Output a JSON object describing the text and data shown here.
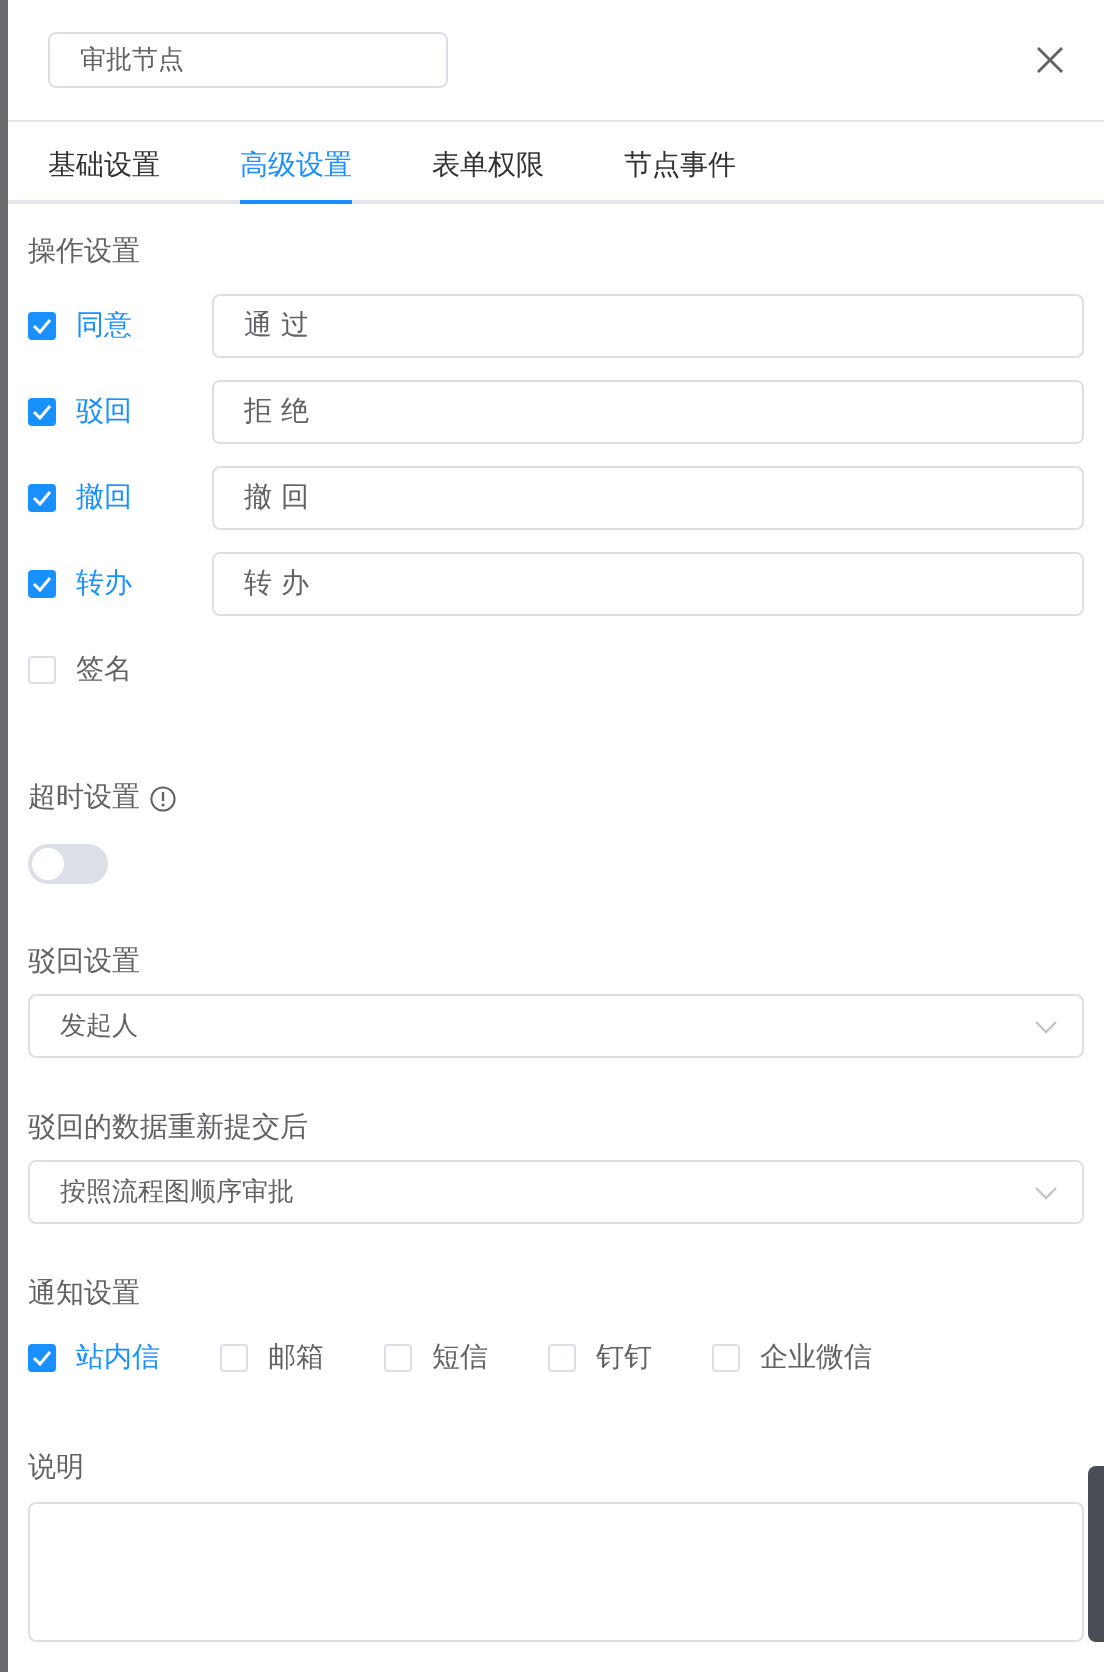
{
  "title_field": {
    "value": "审批节点"
  },
  "tabs": [
    {
      "label": "基础设置",
      "selected": false
    },
    {
      "label": "高级设置",
      "selected": true
    },
    {
      "label": "表单权限",
      "selected": false
    },
    {
      "label": "节点事件",
      "selected": false
    }
  ],
  "operations": {
    "label": "操作设置",
    "items": [
      {
        "kind": "with-input",
        "label": "同意",
        "checked": true,
        "value": "通 过"
      },
      {
        "kind": "with-input",
        "label": "驳回",
        "checked": true,
        "value": "拒 绝"
      },
      {
        "kind": "with-input",
        "label": "撤回",
        "checked": true,
        "value": "撤 回"
      },
      {
        "kind": "with-input",
        "label": "转办",
        "checked": true,
        "value": "转 办"
      },
      {
        "kind": "plain",
        "label": "签名",
        "checked": false
      }
    ]
  },
  "timeout": {
    "label": "超时设置",
    "on": false
  },
  "reject": {
    "label": "驳回设置",
    "value": "发起人"
  },
  "resubmit": {
    "label": "驳回的数据重新提交后",
    "value": "按照流程图顺序审批"
  },
  "notify": {
    "label": "通知设置",
    "options": [
      {
        "label": "站内信",
        "checked": true
      },
      {
        "label": "邮箱",
        "checked": false
      },
      {
        "label": "短信",
        "checked": false
      },
      {
        "label": "钉钉",
        "checked": false
      },
      {
        "label": "企业微信",
        "checked": false
      }
    ]
  },
  "description": {
    "label": "说明"
  }
}
